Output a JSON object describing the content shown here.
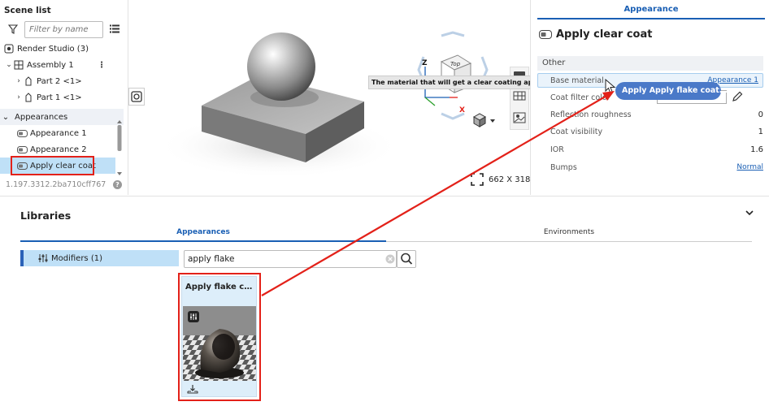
{
  "scene_list": {
    "title": "Scene list",
    "filter_placeholder": "Filter by name",
    "render_studio": "Render Studio (3)",
    "assembly": "Assembly 1",
    "parts": [
      "Part 2 <1>",
      "Part 1 <1>"
    ],
    "appearances_header": "Appearances",
    "appearances": [
      "Appearance 1",
      "Appearance 2",
      "Apply clear coat"
    ],
    "selected_appearance": "Apply clear coat",
    "version": "1.197.3312.2ba710cff767",
    "help": "?"
  },
  "viewport": {
    "resolution": "662 X 318",
    "tooltip": "The material that will get a clear coating applied",
    "view_cube_face": "Top",
    "view_cube_front": "Front",
    "axis_z": "Z",
    "axis_x": "X"
  },
  "appearance_panel": {
    "tab": "Appearance",
    "title": "Apply clear coat",
    "group": "Other",
    "properties": [
      {
        "label": "Base material",
        "value": "Appearance 1"
      },
      {
        "label": "Coat filter color",
        "value": ""
      },
      {
        "label": "Reflection roughness",
        "value": "0"
      },
      {
        "label": "Coat visibility",
        "value": "1"
      },
      {
        "label": "IOR",
        "value": "1.6"
      },
      {
        "label": "Bumps",
        "value": "Normal"
      }
    ],
    "drag_pill": "Apply Apply flake coat..."
  },
  "libraries": {
    "title": "Libraries",
    "tabs": [
      "Appearances",
      "Environments"
    ],
    "modifiers": "Modifiers (1)",
    "search_value": "apply flake",
    "card_title": "Apply flake coa..."
  },
  "colors": {
    "accent": "#1a5fb4",
    "selection": "#bfe0f7",
    "highlight_red": "#e32119",
    "drag_pill": "#4a79c8"
  }
}
